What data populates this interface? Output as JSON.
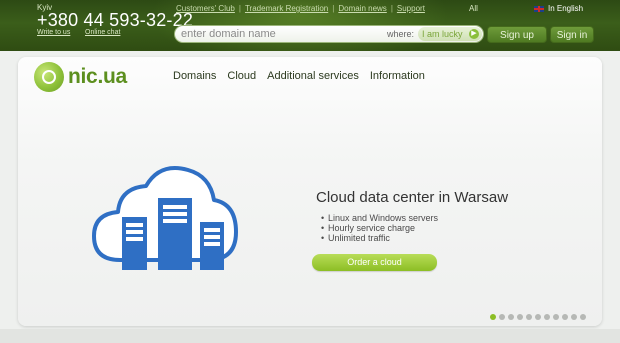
{
  "header": {
    "city": "Kyiv",
    "phone": "+380 44 593-32-22",
    "write_link": "Write to us",
    "chat_link": "Online chat",
    "nav": [
      "Customers' Club",
      "Trademark Registration",
      "Domain news",
      "Support"
    ],
    "all": "All",
    "language": "In English",
    "search_placeholder": "enter domain name",
    "where_label": "where:",
    "lucky_label": "I am lucky",
    "signup": "Sign up",
    "signin": "Sign in"
  },
  "logo": {
    "text": "nic.ua"
  },
  "mainnav": [
    "Domains",
    "Cloud",
    "Additional services",
    "Information"
  ],
  "slide": {
    "title": "Cloud data center in Warsaw",
    "bullets": [
      "Linux and Windows servers",
      "Hourly service charge",
      "Unlimited traffic"
    ],
    "button": "Order a cloud"
  },
  "carousel": {
    "total": 11,
    "active": 0
  },
  "colors": {
    "accent": "#8cbe24",
    "header_green": "#3b5e1a",
    "cloud_blue": "#2f6fc4"
  }
}
